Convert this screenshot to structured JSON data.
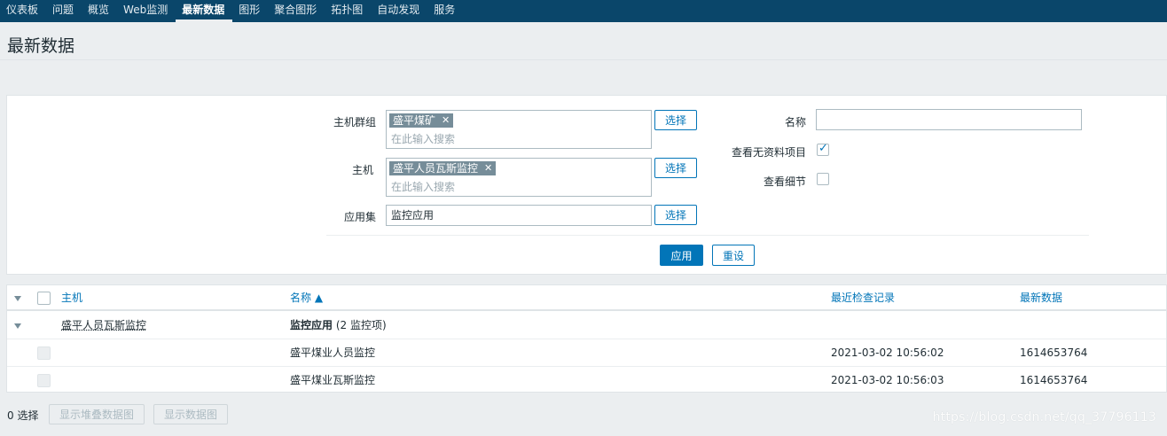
{
  "nav": {
    "items": [
      {
        "label": "仪表板"
      },
      {
        "label": "问题"
      },
      {
        "label": "概览"
      },
      {
        "label": "Web监测"
      },
      {
        "label": "最新数据",
        "active": true
      },
      {
        "label": "图形"
      },
      {
        "label": "聚合图形"
      },
      {
        "label": "拓扑图"
      },
      {
        "label": "自动发现"
      },
      {
        "label": "服务"
      }
    ]
  },
  "page": {
    "title": "最新数据"
  },
  "filter": {
    "host_groups_label": "主机群组",
    "host_groups_tag": "盛平煤矿",
    "host_groups_placeholder": "在此输入搜索",
    "hosts_label": "主机",
    "hosts_tag": "盛平人员瓦斯监控",
    "hosts_placeholder": "在此输入搜索",
    "application_label": "应用集",
    "application_value": "监控应用",
    "select_label": "选择",
    "name_label": "名称",
    "name_value": "",
    "show_without_data_label": "查看无资料项目",
    "show_without_data_checked": true,
    "show_details_label": "查看细节",
    "show_details_checked": false,
    "apply_label": "应用",
    "reset_label": "重设"
  },
  "table": {
    "headers": {
      "host": "主机",
      "name": "名称 ▲",
      "last_check": "最近检查记录",
      "last_value": "最新数据"
    },
    "group": {
      "host": "盛平人员瓦斯监控",
      "app_name": "监控应用",
      "app_count": "(2 监控项)"
    },
    "rows": [
      {
        "name": "盛平煤业人员监控",
        "last_check": "2021-03-02 10:56:02",
        "last_value": "1614653764"
      },
      {
        "name": "盛平煤业瓦斯监控",
        "last_check": "2021-03-02 10:56:03",
        "last_value": "1614653764"
      }
    ]
  },
  "footer": {
    "selected": "0 选择",
    "btn_stacked": "显示堆叠数据图",
    "btn_graph": "显示数据图"
  },
  "watermark": "https://blog.csdn.net/qq_37796113",
  "colors": {
    "nav_bg": "#0a466a",
    "primary": "#0275b8",
    "tag_bg": "#768d99"
  }
}
